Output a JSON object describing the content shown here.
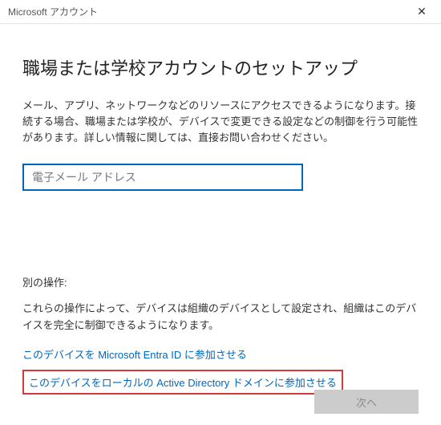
{
  "titlebar": {
    "title": "Microsoft アカウント"
  },
  "main": {
    "heading": "職場または学校アカウントのセットアップ",
    "description": "メール、アプリ、ネットワークなどのリソースにアクセスできるようになります。接続する場合、職場または学校が、デバイスで変更できる設定などの制御を行う可能性があります。詳しい情報に関しては、直接お問い合わせください。",
    "email_placeholder": "電子メール アドレス",
    "email_value": ""
  },
  "alternative": {
    "label": "別の操作:",
    "description": "これらの操作によって、デバイスは組織のデバイスとして設定され、組織はこのデバイスを完全に制御できるようになります。",
    "links": {
      "entra": "このデバイスを Microsoft Entra ID に参加させる",
      "local_ad": "このデバイスをローカルの Active Directory ドメインに参加させる"
    }
  },
  "footer": {
    "next_label": "次へ"
  }
}
